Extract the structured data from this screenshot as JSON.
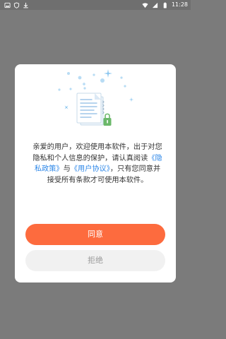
{
  "status_bar": {
    "time": "11:28",
    "left_icons": [
      "image-icon",
      "shield-icon",
      "download-icon"
    ],
    "right_icons": [
      "wifi-icon",
      "signal-icon",
      "battery-icon"
    ]
  },
  "dialog": {
    "text_before_1": "亲爱的用户，欢迎使用本软件，出于对您隐私和个人信息的保护，请认真阅读",
    "privacy_link": "《隐私政策》",
    "text_between": "与",
    "agreement_link": "《用户协议》",
    "text_after": "，只有您同意并接受所有条款才可使用本软件。",
    "agree_label": "同意",
    "reject_label": "拒绝"
  },
  "colors": {
    "overlay": "#7b7b7b",
    "accent": "#fd6b3e",
    "link": "#2f88e8",
    "reject_bg": "#f1f1f1"
  }
}
